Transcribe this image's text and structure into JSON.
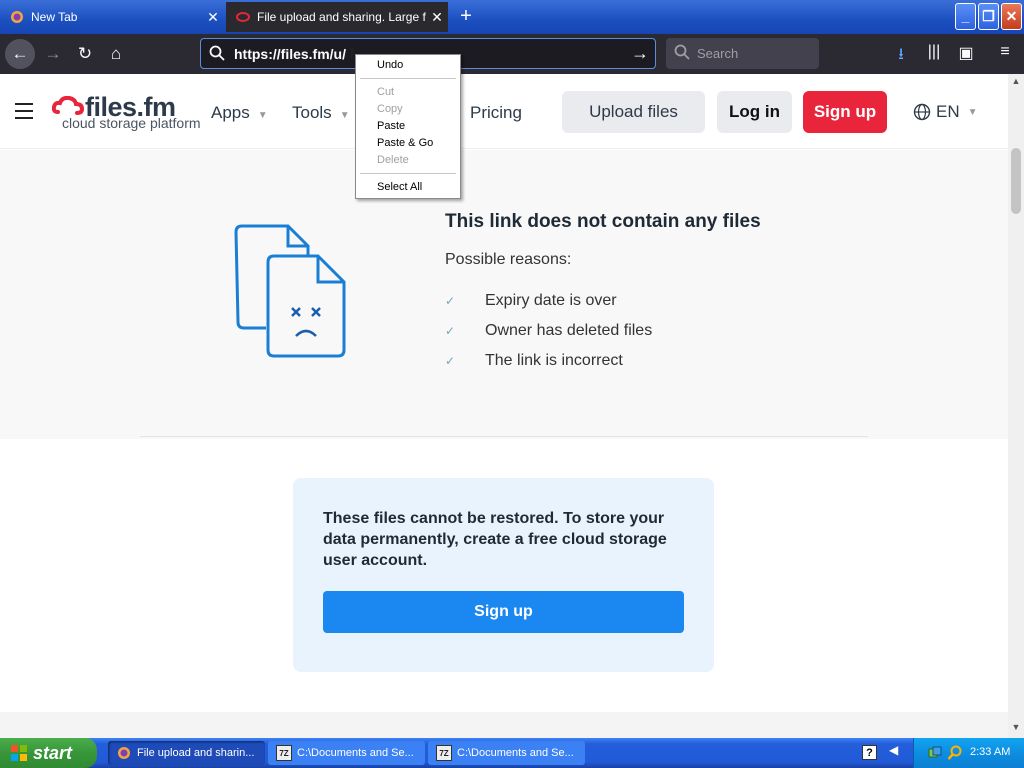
{
  "browser": {
    "tabs": [
      {
        "title": "New Tab"
      },
      {
        "title": "File upload and sharing. Large file"
      }
    ],
    "url": "https://files.fm/u/",
    "search_placeholder": "Search"
  },
  "context_menu": {
    "items": [
      "Undo",
      "Cut",
      "Copy",
      "Paste",
      "Paste & Go",
      "Delete",
      "Select All"
    ]
  },
  "site": {
    "logo_name": "files.fm",
    "logo_tagline": "cloud storage platform",
    "nav": [
      "Apps",
      "Tools",
      "Pricing"
    ],
    "upload_label": "Upload files",
    "login_label": "Log in",
    "signup_label": "Sign up",
    "language": "EN",
    "accent_red": "#e8253a",
    "accent_blue": "#1a88f0"
  },
  "message": {
    "title": "This link does not contain any files",
    "subtitle": "Possible reasons:",
    "reasons": [
      "Expiry date is over",
      "Owner has deleted files",
      "The link is incorrect"
    ]
  },
  "notice": {
    "text": "These files cannot be restored. To store your data permanently, create a free cloud storage user account.",
    "button_label": "Sign up"
  },
  "taskbar": {
    "start_label": "start",
    "tasks": [
      {
        "label": "File upload and sharin..."
      },
      {
        "label": "C:\\Documents and Se..."
      },
      {
        "label": "C:\\Documents and Se..."
      }
    ],
    "task_badge": "7Z",
    "help_label": "?",
    "clock": "2:33 AM"
  }
}
